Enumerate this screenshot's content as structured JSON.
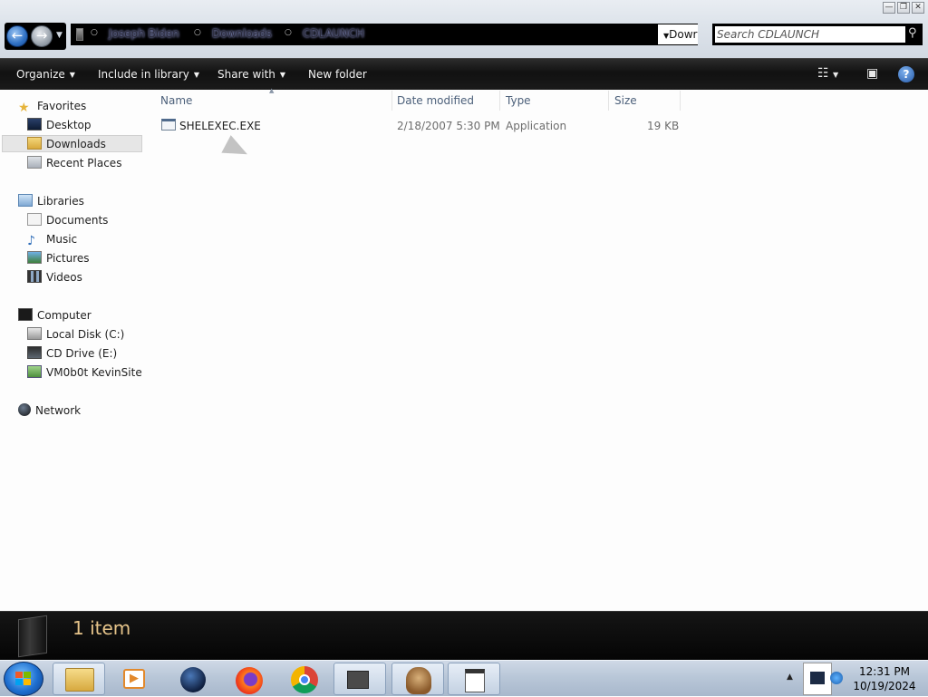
{
  "window": {
    "caption_buttons": [
      "—",
      "❐",
      "✕"
    ]
  },
  "address": {
    "crumbs": [
      "Joseph Biden",
      "Downloads",
      "CDLAUNCH"
    ],
    "recent_label": "Dowr",
    "search_value": "Search CDLAUNCH"
  },
  "toolbar": {
    "organize": "Organize",
    "include_in_library": "Include in library",
    "share_with": "Share with",
    "new_folder": "New folder",
    "help": "?"
  },
  "nav": {
    "favorites": "Favorites",
    "desktop": "Desktop",
    "downloads": "Downloads",
    "recent_places": "Recent Places",
    "libraries": "Libraries",
    "documents": "Documents",
    "music": "Music",
    "pictures": "Pictures",
    "videos": "Videos",
    "computer": "Computer",
    "local_disk": "Local Disk (C:)",
    "cd_drive": "CD Drive (E:)",
    "vm_share": "VM0b0t KevinSite",
    "network": "Network"
  },
  "columns": {
    "name": "Name",
    "date_modified": "Date modified",
    "type": "Type",
    "size": "Size"
  },
  "files": [
    {
      "name": "SHELEXEC.EXE",
      "date_modified": "2/18/2007 5:30 PM",
      "type": "Application",
      "size": "19 KB"
    }
  ],
  "details": {
    "count": "1 item"
  },
  "taskbar": {
    "time": "12:31 PM",
    "date": "10/19/2024",
    "colors": {
      "accent": "#1e6fd0"
    }
  }
}
